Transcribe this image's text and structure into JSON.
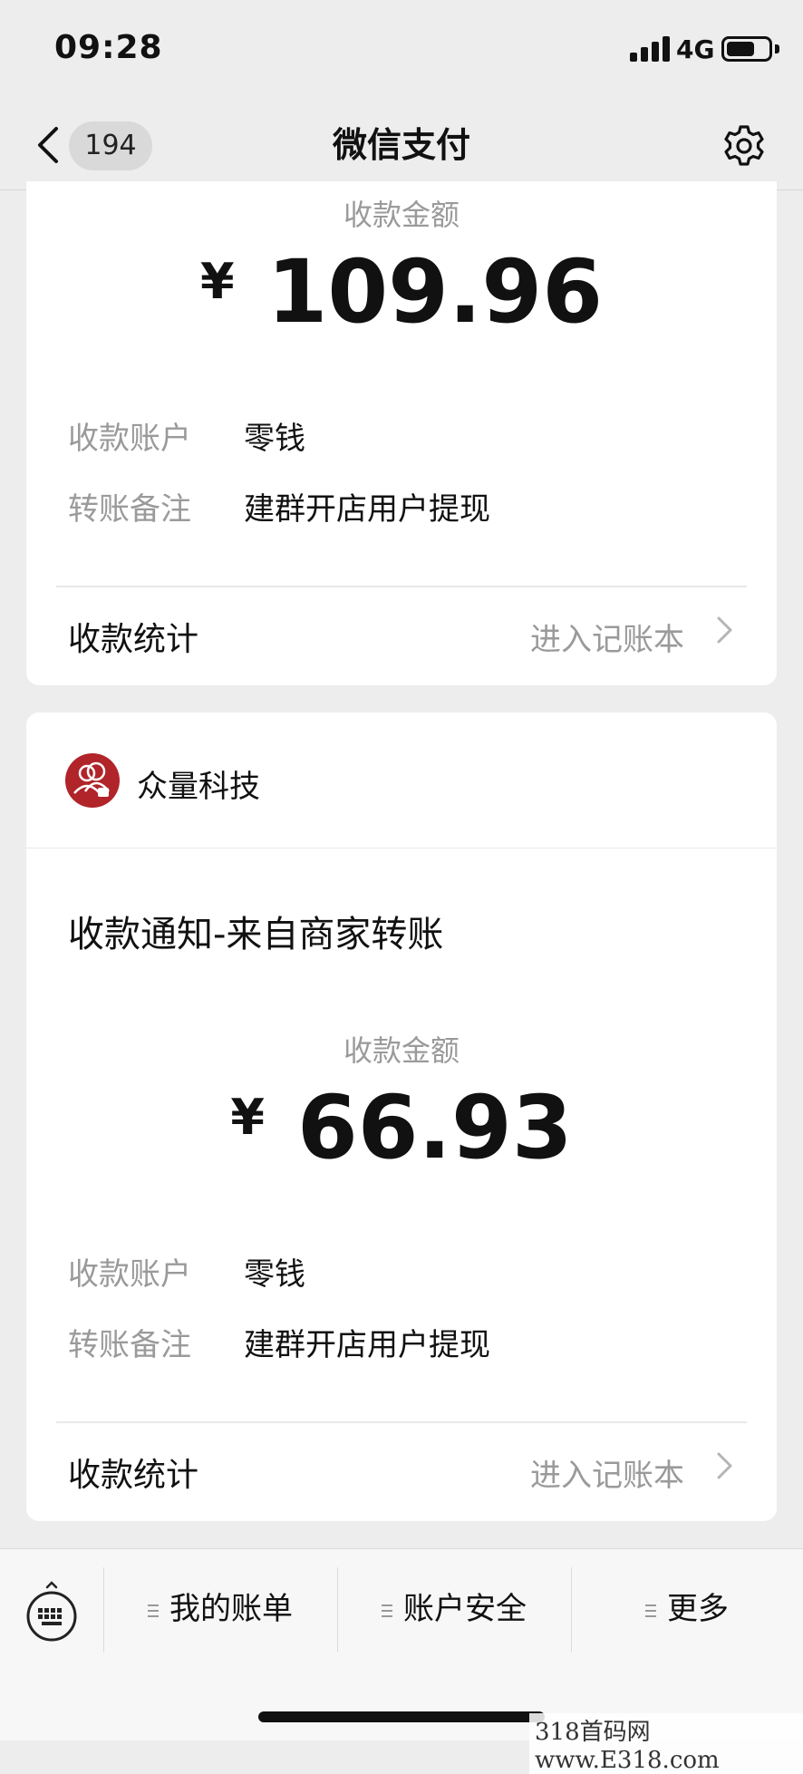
{
  "status_bar": {
    "time": "09:28",
    "network": "4G"
  },
  "nav": {
    "back_count": "194",
    "title": "微信支付"
  },
  "cards": [
    {
      "amount_label": "收款金额",
      "currency": "¥",
      "amount": "109.96",
      "account_label": "收款账户",
      "account_value": "零钱",
      "remark_label": "转账备注",
      "remark_value": "建群开店用户提现",
      "stats_label": "收款统计",
      "stats_link": "进入记账本"
    },
    {
      "merchant_name": "众量科技",
      "notice_title": "收款通知-来自商家转账",
      "amount_label": "收款金额",
      "currency": "¥",
      "amount": "66.93",
      "account_label": "收款账户",
      "account_value": "零钱",
      "remark_label": "转账备注",
      "remark_value": "建群开店用户提现",
      "stats_label": "收款统计",
      "stats_link": "进入记账本"
    }
  ],
  "bottom_menu": {
    "items": [
      "我的账单",
      "账户安全",
      "更多"
    ]
  },
  "watermark": "318首码网 www.E318.com",
  "colors": {
    "background": "#ededed",
    "card": "#ffffff",
    "muted_text": "#9a9a9a",
    "merchant_logo": "#b0242a"
  }
}
